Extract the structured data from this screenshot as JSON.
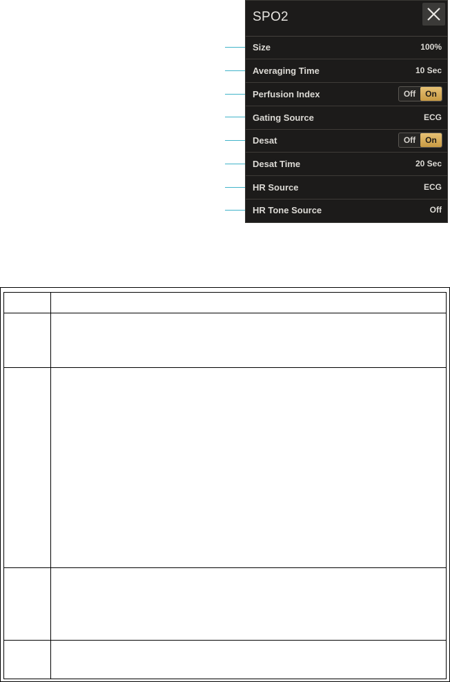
{
  "panel": {
    "title": "SPO2",
    "close_icon": "close-x-icon",
    "rows": [
      {
        "label": "Size",
        "value": "100%"
      },
      {
        "label": "Averaging Time",
        "value": "10 Sec"
      },
      {
        "label": "Perfusion Index",
        "toggle": {
          "off": "Off",
          "on": "On",
          "selected": "On"
        }
      },
      {
        "label": "Gating Source",
        "value": "ECG"
      },
      {
        "label": "Desat",
        "toggle": {
          "off": "Off",
          "on": "On",
          "selected": "On"
        }
      },
      {
        "label": "Desat Time",
        "value": "20 Sec"
      },
      {
        "label": "HR Source",
        "value": "ECG"
      },
      {
        "label": "HR Tone Source",
        "value": "Off"
      }
    ]
  },
  "colors": {
    "panel_bg": "#1c1b1a",
    "toggle_active": "#d4a955",
    "callout_line": "#3fb3c9"
  },
  "table": {
    "rows": 5,
    "columns": 2
  }
}
